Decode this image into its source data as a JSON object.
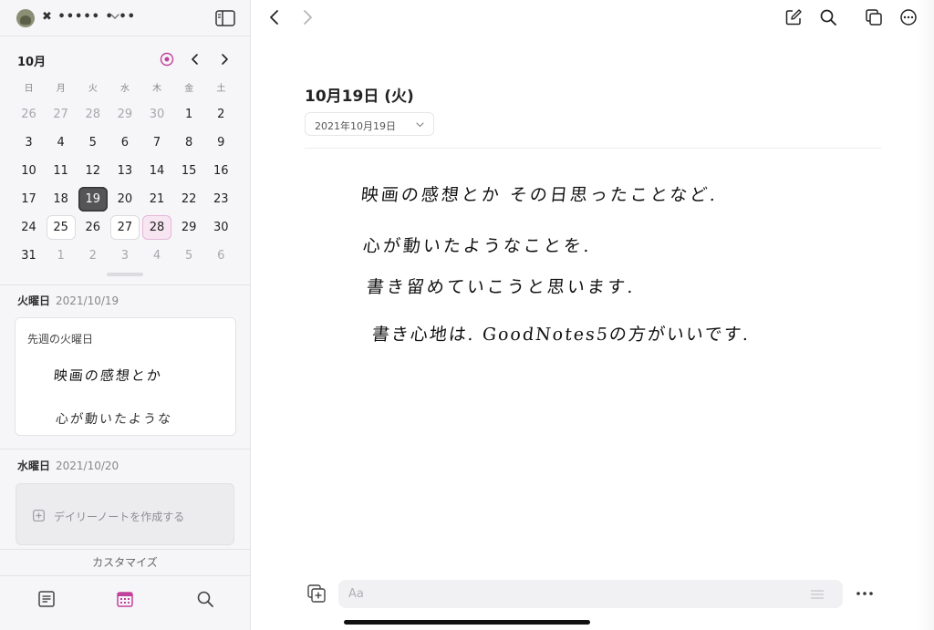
{
  "sidebar": {
    "username": "✖ ••••• • ••",
    "month_label": "10月",
    "weekdays": [
      "日",
      "月",
      "火",
      "水",
      "木",
      "金",
      "土"
    ],
    "calendar_rows": [
      [
        "26",
        "27",
        "28",
        "29",
        "30",
        "1",
        "2"
      ],
      [
        "3",
        "4",
        "5",
        "6",
        "7",
        "8",
        "9"
      ],
      [
        "10",
        "11",
        "12",
        "13",
        "14",
        "15",
        "16"
      ],
      [
        "17",
        "18",
        "19",
        "20",
        "21",
        "22",
        "23"
      ],
      [
        "24",
        "25",
        "26",
        "27",
        "28",
        "29",
        "30"
      ],
      [
        "31",
        "1",
        "2",
        "3",
        "4",
        "5",
        "6"
      ]
    ],
    "day1": {
      "weekday": "火曜日",
      "date": "2021/10/19"
    },
    "note_card": {
      "title": "先週の火曜日",
      "preview_line1": "映画の感想とか",
      "preview_line2": "心が動いたような"
    },
    "day2": {
      "weekday": "水曜日",
      "date": "2021/10/20"
    },
    "create_note_label": "デイリーノートを作成する",
    "customize_label": "カスタマイズ"
  },
  "main": {
    "date_title": "10月19日 (火)",
    "date_picker_value": "2021年10月19日",
    "handwriting": [
      "映画の感想とか その日思ったことなど.",
      "心が動いたようなことを.",
      "書き留めていこうと思います.",
      "書き心地は. GoodNotes5の方がいいです."
    ],
    "input_placeholder": "Aa"
  },
  "colors": {
    "accent_pink": "#c2419b",
    "selected_day": "#555558",
    "today_bg": "#f7e6f2"
  },
  "icons": {
    "sidebar_toggle": "sidebar-toggle-icon",
    "today": "target-icon",
    "back": "chevron-left-icon",
    "forward": "chevron-right-icon",
    "compose": "compose-icon",
    "search": "search-icon",
    "windows": "windows-icon",
    "more": "more-icon"
  }
}
